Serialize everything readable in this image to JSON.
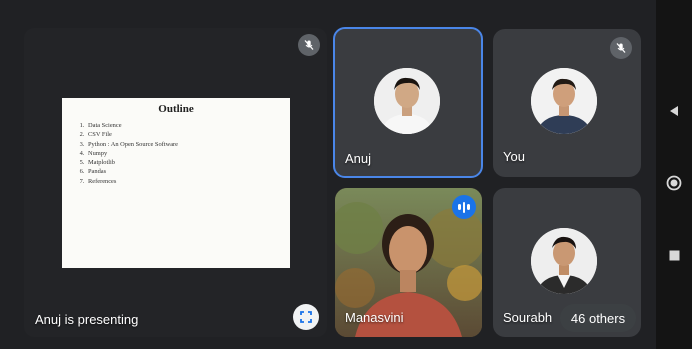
{
  "presentation": {
    "caption": "Anuj is presenting",
    "slide_title": "Outline",
    "slide_items": [
      "Data Science",
      "CSV File",
      "Python : An Open Source Software",
      "Numpy",
      "Matplotlib",
      "Pandas",
      "References"
    ]
  },
  "participants": {
    "anuj": "Anuj",
    "you": "You",
    "manasvini": "Manasvini",
    "sourabh": "Sourabh"
  },
  "others_label": "46 others",
  "colors": {
    "speaker_border": "#4a86e8",
    "screen_bg": "#202124",
    "tile_bg": "#3a3c40",
    "speaking_badge": "#1a73e8"
  },
  "icons": [
    "mic-off-icon",
    "fullscreen-icon",
    "speaking-icon",
    "back-icon",
    "home-icon",
    "recents-icon"
  ]
}
